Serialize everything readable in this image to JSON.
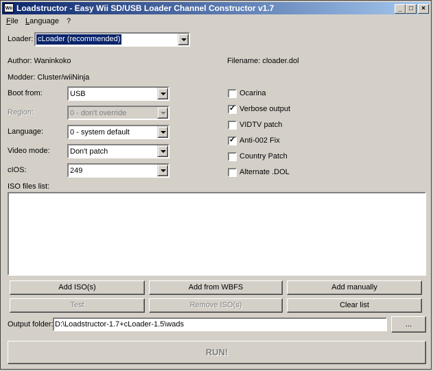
{
  "window": {
    "icon_text": "Wii",
    "title": "Loadstructor - Easy Wii SD/USB Loader Channel Constructor v1.7",
    "controls": {
      "minimize": "_",
      "maximize": "□",
      "close": "×"
    }
  },
  "menu": {
    "file": {
      "accel": "F",
      "rest": "ile"
    },
    "language": {
      "accel": "L",
      "rest": "anguage"
    },
    "help": "?"
  },
  "loader": {
    "label": "Loader:",
    "value": "cLoader (recommended)"
  },
  "info": {
    "author": "Author: Waninkoko",
    "modder": "Modder: Cluster/wiiNinja",
    "filename": "Filename: cloader.dol"
  },
  "fields": {
    "boot_from": {
      "label": "Boot from:",
      "value": "USB",
      "disabled": false
    },
    "region": {
      "label": "Region:",
      "value": "0 - don't override",
      "disabled": true
    },
    "language": {
      "label": "Language:",
      "value": "0 - system default",
      "disabled": false
    },
    "video_mode": {
      "label": "Video mode:",
      "value": "Don't patch",
      "disabled": false
    },
    "cios": {
      "label": "cIOS:",
      "value": "249",
      "disabled": false
    }
  },
  "options": {
    "ocarina": {
      "label": "Ocarina",
      "checked": false
    },
    "verbose": {
      "label": "Verbose output",
      "checked": true
    },
    "vidtv": {
      "label": "VIDTV patch",
      "checked": false
    },
    "anti002": {
      "label": "Anti-002 Fix",
      "checked": true
    },
    "country": {
      "label": "Country Patch",
      "checked": false
    },
    "altdol": {
      "label": "Alternate .DOL",
      "checked": false
    }
  },
  "iso_list": {
    "label": "ISO files list:",
    "items": []
  },
  "buttons": {
    "add_iso": "Add ISO(s)",
    "add_wbfs": "Add from WBFS",
    "add_manually": "Add manually",
    "test": "Test",
    "remove_iso": "Remove ISO(s)",
    "clear_list": "Clear list",
    "browse": "...",
    "run": "RUN!"
  },
  "output": {
    "label": "Output folder:",
    "value": "D:\\Loadstructor-1.7+cLoader-1.5\\wads"
  },
  "check_mark": "✓"
}
